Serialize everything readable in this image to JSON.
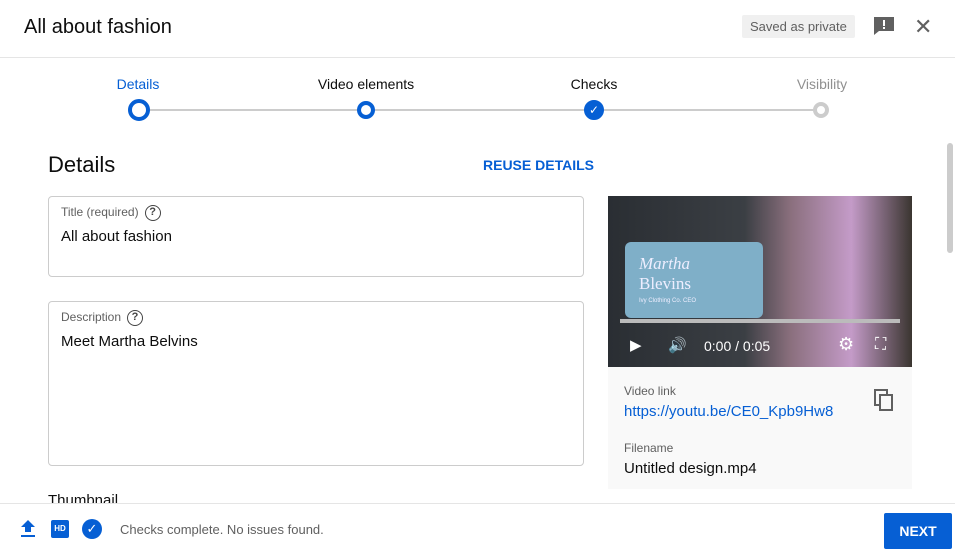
{
  "header": {
    "title": "All about fashion",
    "saved": "Saved as private"
  },
  "steps": [
    {
      "label": "Details",
      "state": "active"
    },
    {
      "label": "Video elements",
      "state": "done"
    },
    {
      "label": "Checks",
      "state": "checked"
    },
    {
      "label": "Visibility",
      "state": "pending"
    }
  ],
  "details": {
    "heading": "Details",
    "reuse": "REUSE DETAILS",
    "title_label": "Title (required)",
    "title_value": "All about fashion",
    "desc_label": "Description",
    "desc_value": "Meet Martha Belvins",
    "thumbnail_label": "Thumbnail"
  },
  "video": {
    "card_name1": "Martha",
    "card_name2": "Blevins",
    "card_sub": "Ivy Clothing Co. CEO",
    "time": "0:00 / 0:05",
    "link_label": "Video link",
    "link": "https://youtu.be/CE0_Kpb9Hw8",
    "filename_label": "Filename",
    "filename": "Untitled design.mp4"
  },
  "footer": {
    "status": "Checks complete. No issues found.",
    "hd": "HD",
    "next": "NEXT"
  },
  "colors": {
    "accent": "#065fd4"
  }
}
